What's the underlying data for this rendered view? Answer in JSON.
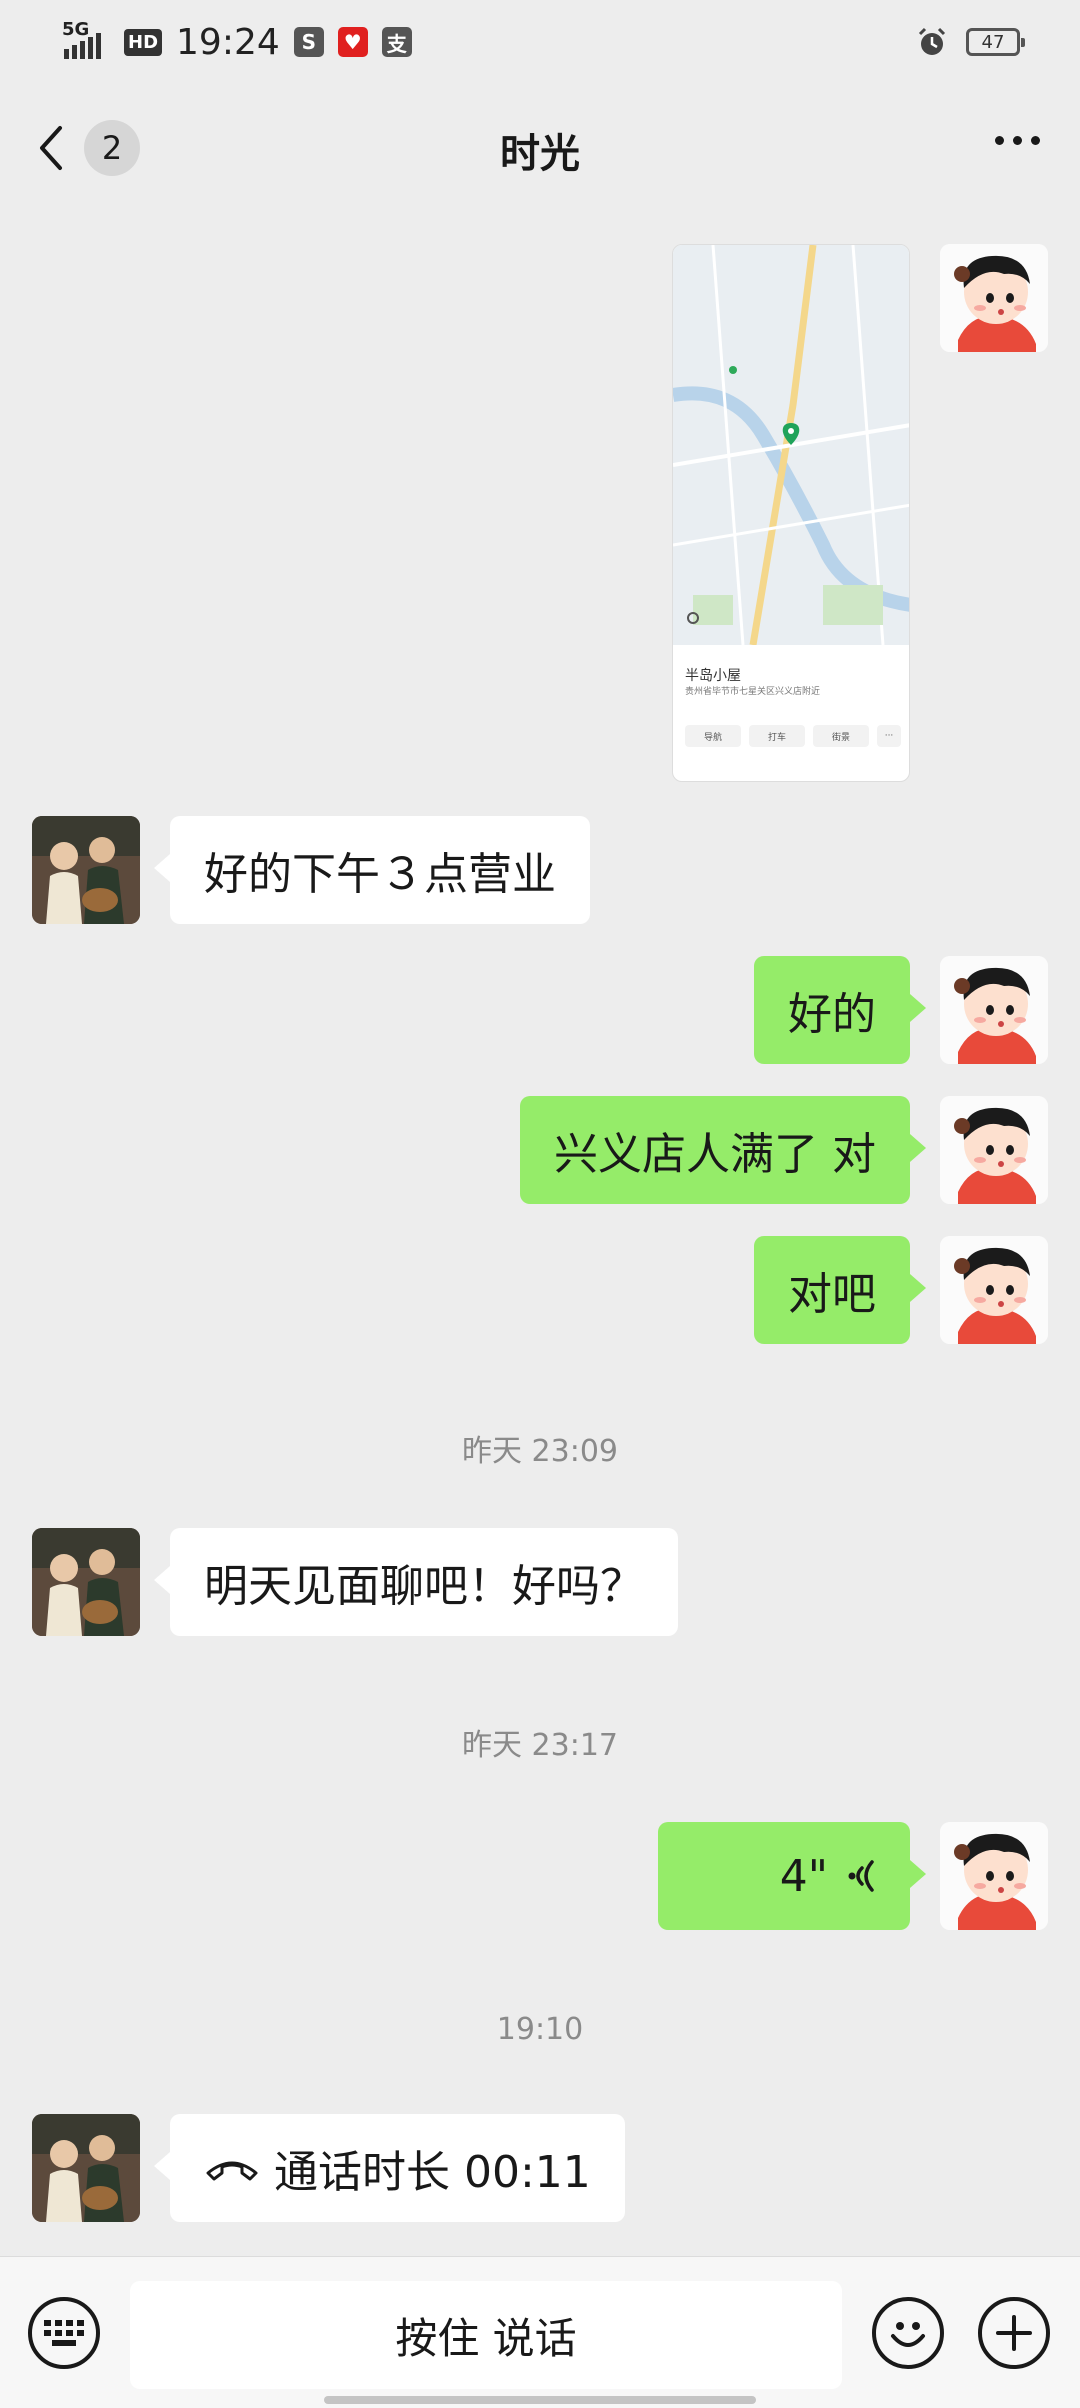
{
  "status_bar": {
    "network": "5G",
    "hd": "HD",
    "time": "19:24",
    "app_icon_1": "S",
    "app_icon_3": "支",
    "battery": "47"
  },
  "nav": {
    "unread_count": "2",
    "title": "时光"
  },
  "location_card": {
    "title": "半岛小屋",
    "address": "贵州省毕节市七星关区兴义店附近",
    "buttons": [
      "导航",
      "打车",
      "街景",
      "···"
    ]
  },
  "messages": [
    {
      "from": "them",
      "text": "好的下午３点营业"
    },
    {
      "from": "me",
      "text": "好的"
    },
    {
      "from": "me",
      "text": "兴义店人满了 对"
    },
    {
      "from": "me",
      "text": "对吧"
    },
    {
      "from": "them",
      "text": "明天见面聊吧！好吗？"
    },
    {
      "from": "me",
      "type": "voice",
      "text": "4\""
    },
    {
      "from": "them",
      "type": "call",
      "text": "通话时长 00:11"
    }
  ],
  "timestamps": [
    "昨天 23:09",
    "昨天 23:17",
    "19:10"
  ],
  "input_bar": {
    "hold_to_talk": "按住 说话",
    "left_icon": "keyboard-icon",
    "emoji_icon": "emoji-icon",
    "plus_icon": "plus-icon"
  },
  "colors": {
    "background": "#ededed",
    "my_bubble": "#95ec69",
    "their_bubble": "#ffffff"
  }
}
